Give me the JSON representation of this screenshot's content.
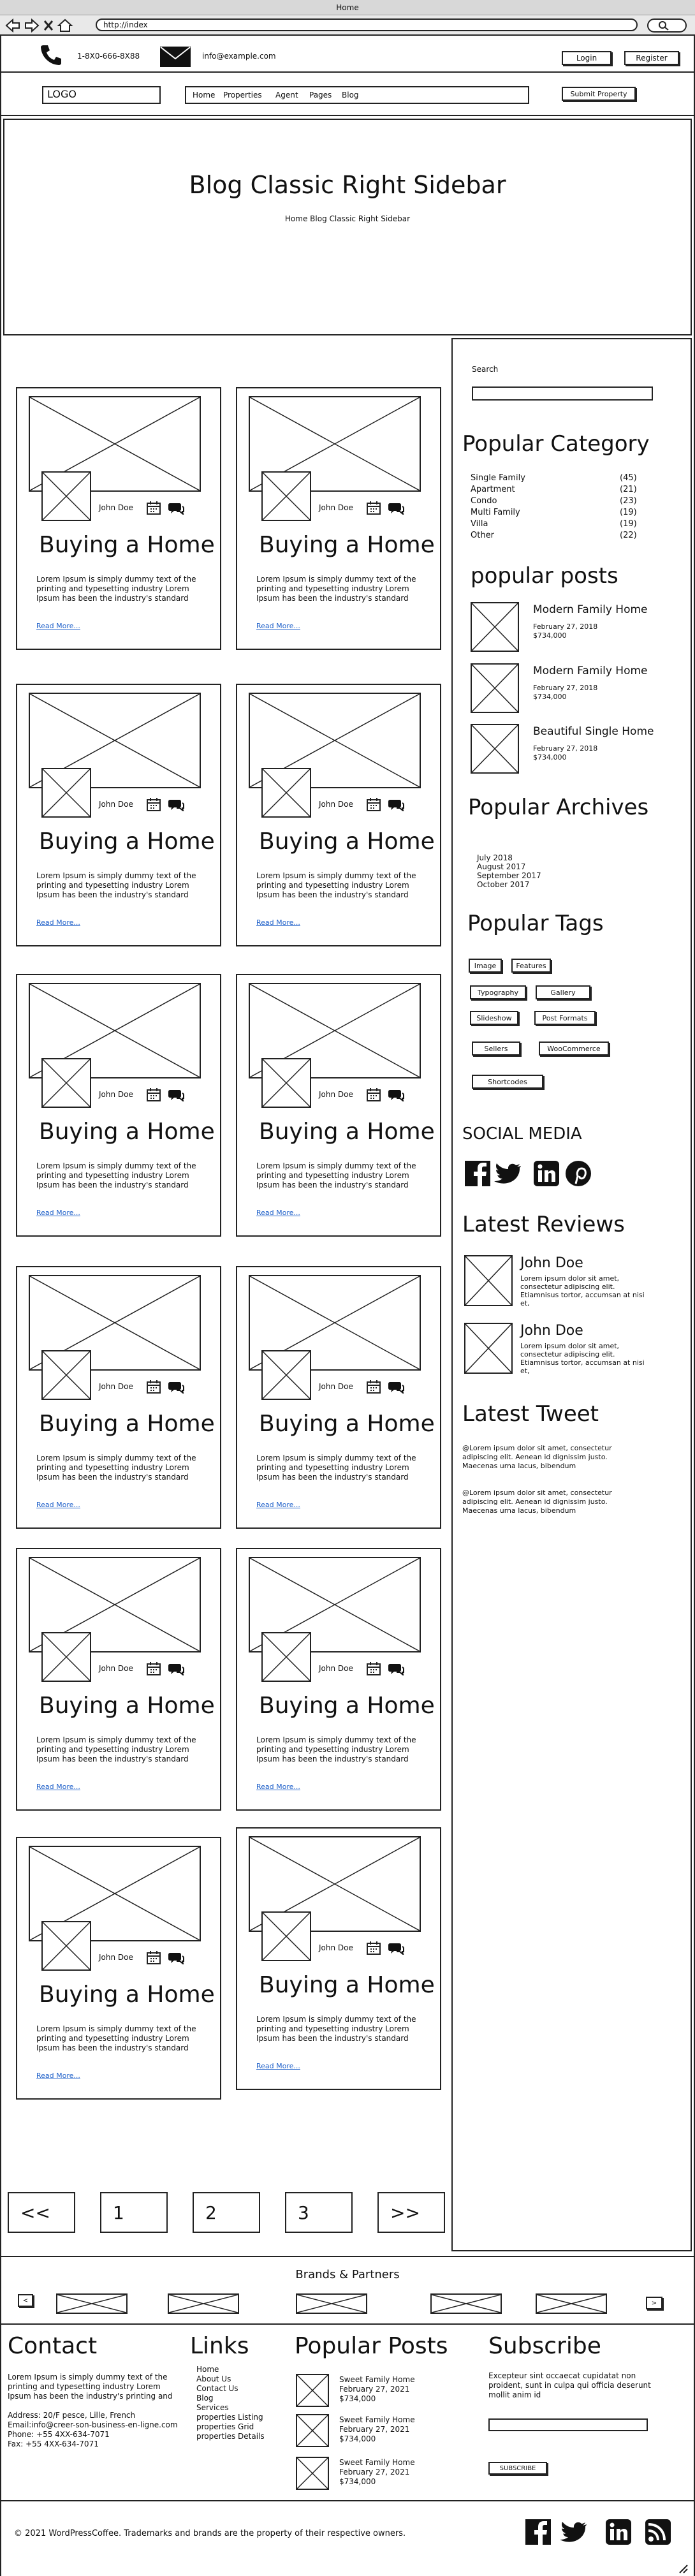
{
  "browser": {
    "title": "Home",
    "url": "http://index"
  },
  "contact_bar": {
    "phone": "1-8X0-666-8X88",
    "email": "info@example.com",
    "login": "Login",
    "register": "Register"
  },
  "nav": {
    "logo": "LOGO",
    "items": [
      "Home",
      "Properties",
      "Agent",
      "Pages",
      "Blog"
    ],
    "submit": "Submit Property"
  },
  "hero": {
    "title": "Blog Classic Right Sidebar",
    "breadcrumb": "Home Blog Classic Right Sidebar"
  },
  "post": {
    "author": "John Doe",
    "title": "Buying a Home",
    "excerpt_1": "Lorem Ipsum is simply dummy text of the",
    "excerpt_2": "printing and typesetting industry Lorem",
    "excerpt_3": "Ipsum has been the industry's standard",
    "read_more": "Read More..."
  },
  "posts_count": 12,
  "pagination": [
    "<<",
    "1",
    "2",
    "3",
    ">>"
  ],
  "sidebar": {
    "search_label": "Search",
    "popular_category": {
      "title": "Popular Category",
      "items": [
        {
          "name": "Single Family",
          "count": "(45)"
        },
        {
          "name": "Apartment",
          "count": "(21)"
        },
        {
          "name": "Condo",
          "count": "(23)"
        },
        {
          "name": "Multi Family",
          "count": "(19)"
        },
        {
          "name": "Villa",
          "count": "(19)"
        },
        {
          "name": "Other",
          "count": "(22)"
        }
      ]
    },
    "popular_posts": {
      "title": "popular posts",
      "items": [
        {
          "title": "Modern Family Home",
          "date": "February 27, 2018",
          "price": "$734,000"
        },
        {
          "title": "Modern Family Home",
          "date": "February 27, 2018",
          "price": "$734,000"
        },
        {
          "title": "Beautiful Single Home",
          "date": "February 27, 2018",
          "price": "$734,000"
        }
      ]
    },
    "popular_archives": {
      "title": "Popular Archives",
      "items": [
        "July 2018",
        "August 2017",
        "September 2017",
        "October 2017"
      ]
    },
    "popular_tags": {
      "title": "Popular Tags",
      "items": [
        "Image",
        "Features",
        "Typography",
        "Gallery",
        "Slideshow",
        "Post Formats",
        "Sellers",
        "WooCommerce",
        "Shortcodes"
      ]
    },
    "social": {
      "title": "SOCIAL MEDIA",
      "icons": [
        "facebook-icon",
        "twitter-icon",
        "linkedin-icon",
        "pinterest-icon"
      ]
    },
    "latest_reviews": {
      "title": "Latest Reviews",
      "items": [
        {
          "name": "John Doe",
          "l1": "Lorem ipsum dolor sit amet,",
          "l2": "consectetur adipiscing elit.",
          "l3": "Etiamnisus tortor, accumsan at nisi",
          "l4": "et,"
        },
        {
          "name": "John Doe",
          "l1": "Lorem ipsum dolor sit amet,",
          "l2": "consectetur adipiscing elit.",
          "l3": "Etiamnisus tortor, accumsan at nisi",
          "l4": "et,"
        }
      ]
    },
    "latest_tweet": {
      "title": "Latest Tweet",
      "items": [
        {
          "l1": "@Lorem ipsum dolor sit amet, consectetur",
          "l2": "adipiscing elit. Aenean id dignissim justo.",
          "l3": "Maecenas urna lacus, bibendum"
        },
        {
          "l1": "@Lorem ipsum dolor sit amet, consectetur",
          "l2": "adipiscing elit. Aenean id dignissim justo.",
          "l3": "Maecenas urna lacus, bibendum"
        }
      ]
    }
  },
  "brands": {
    "title": "Brands & Partners",
    "prev": "<",
    "next": ">"
  },
  "footer": {
    "contact": {
      "title": "Contact",
      "l1": "Lorem Ipsum is simply dummy text of the",
      "l2": "printing and typesetting industry Lorem",
      "l3": "Ipsum has been the industry's printing and",
      "address": "Address: 20/F pesce, Lille, French",
      "email": "Email:info@creer-son-business-en-ligne.com",
      "phone": "Phone: +55 4XX-634-7071",
      "fax": "Fax: +55 4XX-634-7071"
    },
    "links": {
      "title": "Links",
      "items": [
        "Home",
        "About Us",
        "Contact Us",
        "Blog",
        "Services",
        "properties Listing",
        "properties Grid",
        "properties Details"
      ]
    },
    "popular_posts": {
      "title": "Popular Posts",
      "items": [
        {
          "title": "Sweet Family Home",
          "date": "February 27, 2021",
          "price": "$734,000"
        },
        {
          "title": "Sweet Family Home",
          "date": "February 27, 2021",
          "price": "$734,000"
        },
        {
          "title": "Sweet Family Home",
          "date": "February 27, 2021",
          "price": "$734,000"
        }
      ]
    },
    "subscribe": {
      "title": "Subscribe",
      "l1": "Excepteur sint occaecat cupidatat non",
      "l2": "proident, sunt in culpa qui officia deserunt",
      "l3": "mollit anim id",
      "button": "SUBSCRIBE"
    },
    "copyright": "© 2021 WordPressCoffee. Trademarks and brands are the property of their respective owners.",
    "social_icons": [
      "facebook-icon",
      "twitter-icon",
      "linkedin-icon",
      "rss-icon"
    ]
  }
}
